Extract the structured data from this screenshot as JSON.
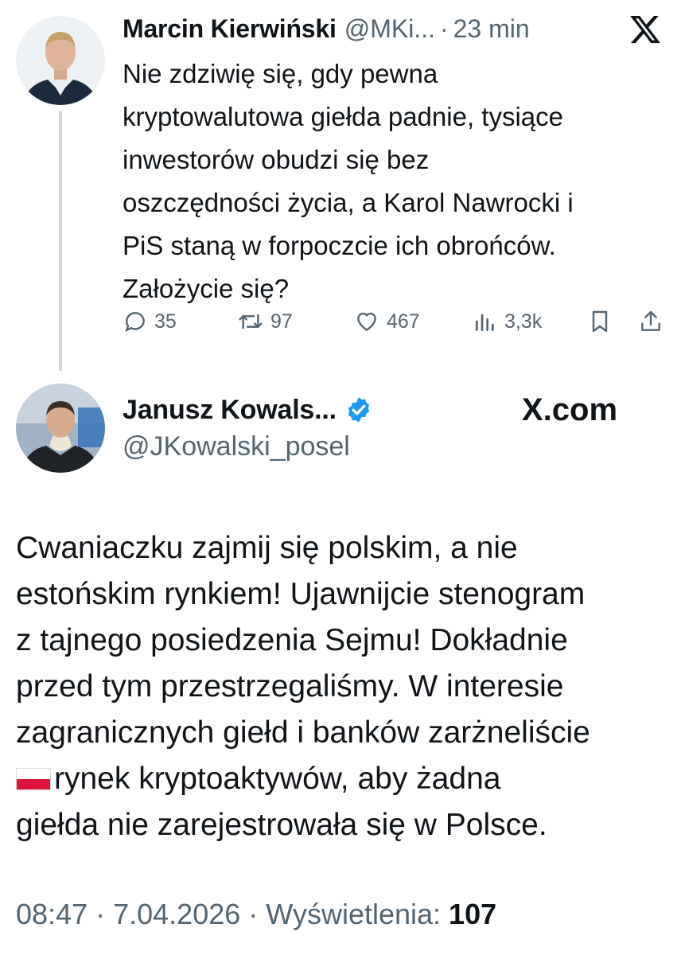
{
  "tweet1": {
    "author_name": "Marcin Kierwiński",
    "author_handle": "@MKi...",
    "separator": "·",
    "time_ago": "23 min",
    "text_lines": [
      "Nie zdziwię się, gdy pewna",
      "kryptowalutowa giełda padnie, tysiące",
      "inwestorów obudzi się bez",
      "oszczędności życia, a Karol Nawrocki i",
      "PiS staną w forpoczcie ich obrońców.",
      "Założycie się?"
    ],
    "replies": "35",
    "reposts": "97",
    "likes": "467",
    "views": "3,3k"
  },
  "tweet2": {
    "author_name": "Janusz Kowals...",
    "author_handle": "@JKowalski_posel",
    "source_label": "X.com",
    "text_lines": [
      "Cwaniaczku zajmij się polskim, a nie",
      "estońskim rynkiem! Ujawnijcie stenogram",
      "z tajnego posiedzenia Sejmu! Dokładnie",
      "przed tym przestrzegaliśmy. W interesie",
      "zagranicznych giełd i banków zarżneliście",
      "rynek kryptoaktywów, aby żadna",
      "giełda nie zarejestrowała się w Polsce."
    ],
    "time": "08:47",
    "date": "7.04.2026",
    "views_label": "Wyświetlenia:",
    "views": "107"
  },
  "colors": {
    "text": "#0f1419",
    "secondary": "#536471",
    "verified": "#1d9bf0",
    "thread_line": "#cfd9de"
  },
  "icons": [
    "x-logo-icon",
    "reply-icon",
    "repost-icon",
    "like-icon",
    "views-icon",
    "bookmark-icon",
    "share-icon",
    "verified-badge-icon",
    "poland-flag-icon"
  ]
}
